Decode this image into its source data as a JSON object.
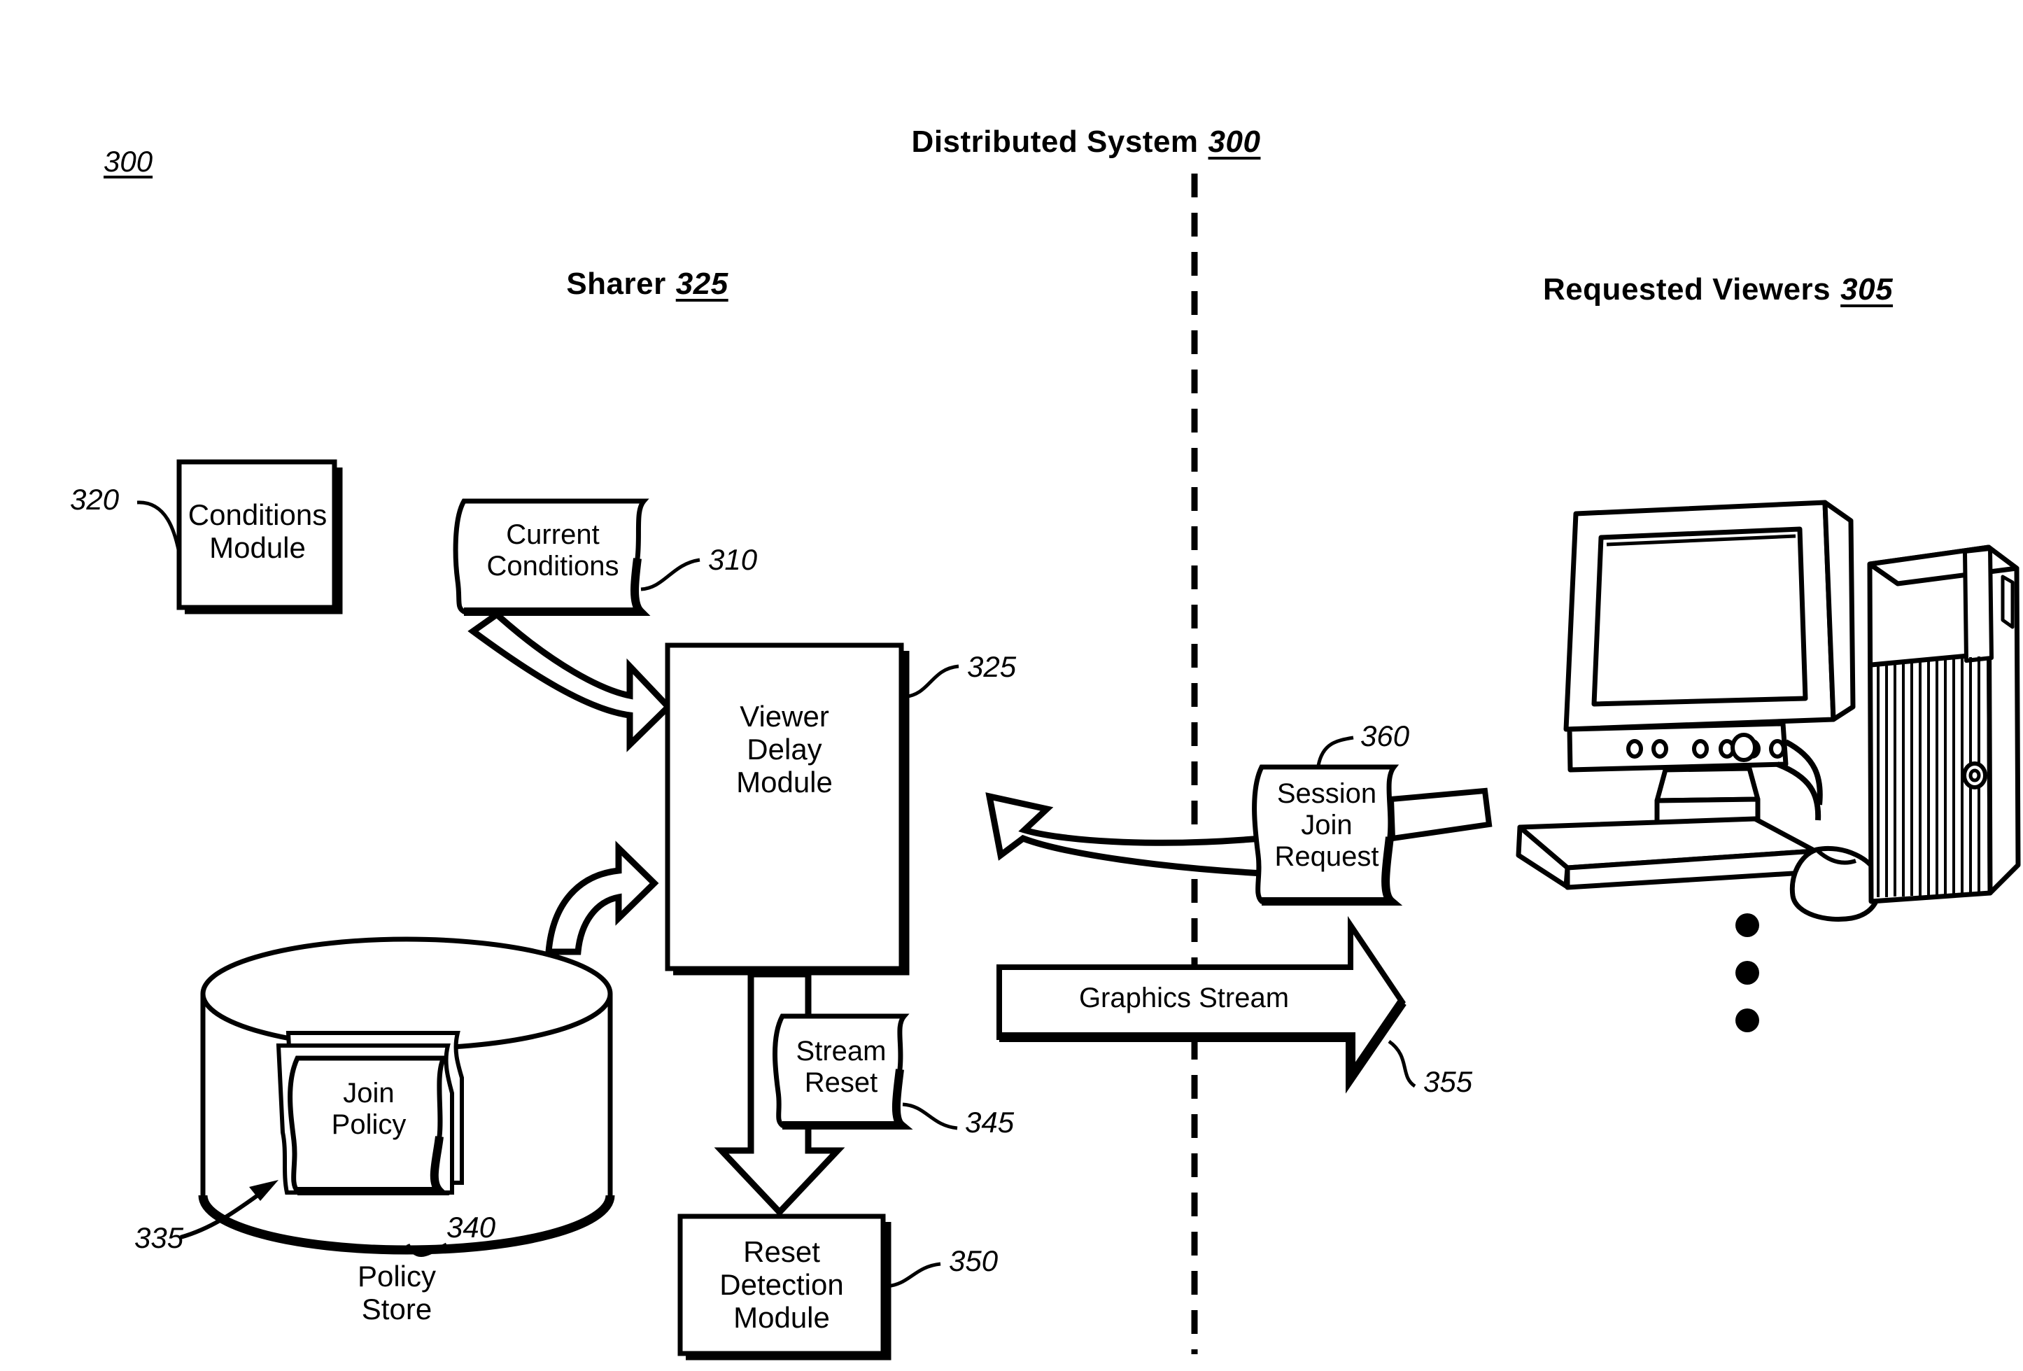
{
  "figure": {
    "figure_number": "300",
    "title_text": "Distributed System",
    "title_number": "300"
  },
  "sections": {
    "left": {
      "label": "Sharer",
      "number": "325"
    },
    "right": {
      "label": "Requested Viewers",
      "number": "305"
    }
  },
  "nodes": {
    "conditions_module": {
      "label": "Conditions\nModule",
      "ref": "320"
    },
    "current_conditions": {
      "label": "Current\nConditions",
      "ref": "310"
    },
    "viewer_delay_module": {
      "label": "Viewer\nDelay\nModule",
      "ref": "325"
    },
    "policy_store": {
      "caption": "Policy\nStore",
      "ref_store": "340",
      "ref_policy": "335"
    },
    "join_policy": {
      "label": "Join\nPolicy"
    },
    "stream_reset": {
      "label": "Stream\nReset",
      "ref": "345"
    },
    "reset_detection_module": {
      "label": "Reset\nDetection\nModule",
      "ref": "350"
    },
    "graphics_stream": {
      "label": "Graphics Stream",
      "ref": "355"
    },
    "session_join_request": {
      "label": "Session\nJoin\nRequest",
      "ref": "360"
    },
    "viewer_computer": {
      "name": "computer-workstation"
    },
    "viewer_ellipsis": {
      "dots": 3
    }
  },
  "colors": {
    "ink": "#000000",
    "paper": "#ffffff"
  }
}
